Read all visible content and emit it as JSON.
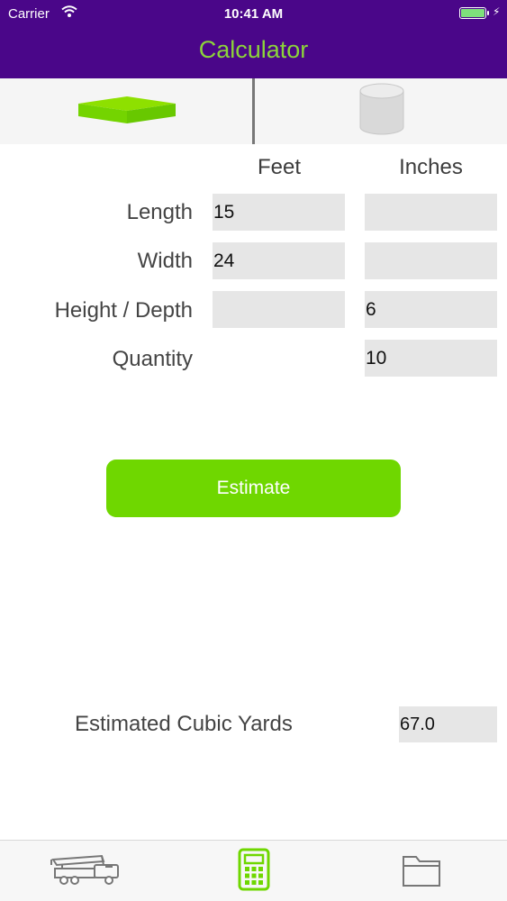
{
  "status_bar": {
    "carrier": "Carrier",
    "time": "10:41 AM"
  },
  "header": {
    "title": "Calculator"
  },
  "shape_selector": {
    "items": [
      {
        "name": "slab-shape-icon",
        "selected": true
      },
      {
        "name": "cylinder-shape-icon",
        "selected": false
      }
    ]
  },
  "columns": {
    "feet": "Feet",
    "inches": "Inches"
  },
  "rows": {
    "length": {
      "label": "Length",
      "feet": "15",
      "inches": ""
    },
    "width": {
      "label": "Width",
      "feet": "24",
      "inches": ""
    },
    "height": {
      "label": "Height / Depth",
      "feet": "",
      "inches": "6"
    },
    "quantity": {
      "label": "Quantity",
      "inches": "10"
    }
  },
  "estimate_button": {
    "label": "Estimate"
  },
  "result": {
    "label": "Estimated Cubic Yards",
    "value": "67.0"
  },
  "tabbar": {
    "items": [
      {
        "name": "pump-truck-icon",
        "active": false
      },
      {
        "name": "calculator-icon",
        "active": true
      },
      {
        "name": "folder-icon",
        "active": false
      }
    ]
  },
  "colors": {
    "header_bg": "#4a0689",
    "accent_green": "#6fd700",
    "title_green": "#8cd43a",
    "field_bg": "#e6e6e6"
  }
}
